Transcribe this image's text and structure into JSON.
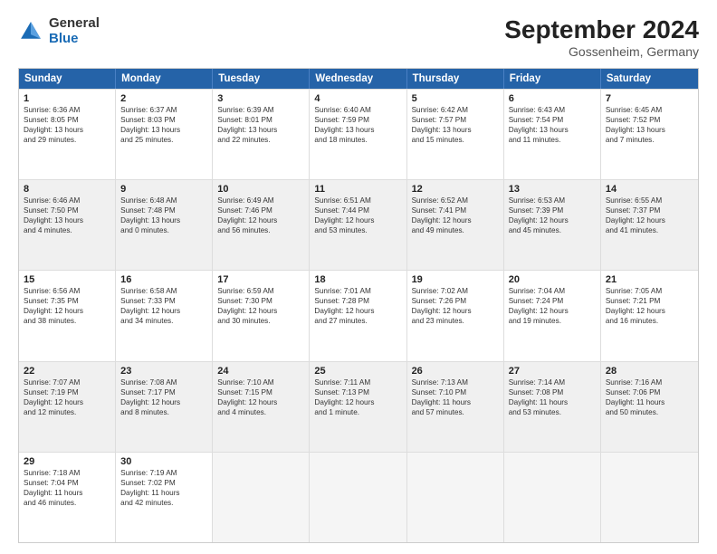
{
  "header": {
    "logo_general": "General",
    "logo_blue": "Blue",
    "month_title": "September 2024",
    "location": "Gossenheim, Germany"
  },
  "weekdays": [
    "Sunday",
    "Monday",
    "Tuesday",
    "Wednesday",
    "Thursday",
    "Friday",
    "Saturday"
  ],
  "rows": [
    [
      {
        "day": "1",
        "lines": [
          "Sunrise: 6:36 AM",
          "Sunset: 8:05 PM",
          "Daylight: 13 hours",
          "and 29 minutes."
        ]
      },
      {
        "day": "2",
        "lines": [
          "Sunrise: 6:37 AM",
          "Sunset: 8:03 PM",
          "Daylight: 13 hours",
          "and 25 minutes."
        ]
      },
      {
        "day": "3",
        "lines": [
          "Sunrise: 6:39 AM",
          "Sunset: 8:01 PM",
          "Daylight: 13 hours",
          "and 22 minutes."
        ]
      },
      {
        "day": "4",
        "lines": [
          "Sunrise: 6:40 AM",
          "Sunset: 7:59 PM",
          "Daylight: 13 hours",
          "and 18 minutes."
        ]
      },
      {
        "day": "5",
        "lines": [
          "Sunrise: 6:42 AM",
          "Sunset: 7:57 PM",
          "Daylight: 13 hours",
          "and 15 minutes."
        ]
      },
      {
        "day": "6",
        "lines": [
          "Sunrise: 6:43 AM",
          "Sunset: 7:54 PM",
          "Daylight: 13 hours",
          "and 11 minutes."
        ]
      },
      {
        "day": "7",
        "lines": [
          "Sunrise: 6:45 AM",
          "Sunset: 7:52 PM",
          "Daylight: 13 hours",
          "and 7 minutes."
        ]
      }
    ],
    [
      {
        "day": "8",
        "lines": [
          "Sunrise: 6:46 AM",
          "Sunset: 7:50 PM",
          "Daylight: 13 hours",
          "and 4 minutes."
        ]
      },
      {
        "day": "9",
        "lines": [
          "Sunrise: 6:48 AM",
          "Sunset: 7:48 PM",
          "Daylight: 13 hours",
          "and 0 minutes."
        ]
      },
      {
        "day": "10",
        "lines": [
          "Sunrise: 6:49 AM",
          "Sunset: 7:46 PM",
          "Daylight: 12 hours",
          "and 56 minutes."
        ]
      },
      {
        "day": "11",
        "lines": [
          "Sunrise: 6:51 AM",
          "Sunset: 7:44 PM",
          "Daylight: 12 hours",
          "and 53 minutes."
        ]
      },
      {
        "day": "12",
        "lines": [
          "Sunrise: 6:52 AM",
          "Sunset: 7:41 PM",
          "Daylight: 12 hours",
          "and 49 minutes."
        ]
      },
      {
        "day": "13",
        "lines": [
          "Sunrise: 6:53 AM",
          "Sunset: 7:39 PM",
          "Daylight: 12 hours",
          "and 45 minutes."
        ]
      },
      {
        "day": "14",
        "lines": [
          "Sunrise: 6:55 AM",
          "Sunset: 7:37 PM",
          "Daylight: 12 hours",
          "and 41 minutes."
        ]
      }
    ],
    [
      {
        "day": "15",
        "lines": [
          "Sunrise: 6:56 AM",
          "Sunset: 7:35 PM",
          "Daylight: 12 hours",
          "and 38 minutes."
        ]
      },
      {
        "day": "16",
        "lines": [
          "Sunrise: 6:58 AM",
          "Sunset: 7:33 PM",
          "Daylight: 12 hours",
          "and 34 minutes."
        ]
      },
      {
        "day": "17",
        "lines": [
          "Sunrise: 6:59 AM",
          "Sunset: 7:30 PM",
          "Daylight: 12 hours",
          "and 30 minutes."
        ]
      },
      {
        "day": "18",
        "lines": [
          "Sunrise: 7:01 AM",
          "Sunset: 7:28 PM",
          "Daylight: 12 hours",
          "and 27 minutes."
        ]
      },
      {
        "day": "19",
        "lines": [
          "Sunrise: 7:02 AM",
          "Sunset: 7:26 PM",
          "Daylight: 12 hours",
          "and 23 minutes."
        ]
      },
      {
        "day": "20",
        "lines": [
          "Sunrise: 7:04 AM",
          "Sunset: 7:24 PM",
          "Daylight: 12 hours",
          "and 19 minutes."
        ]
      },
      {
        "day": "21",
        "lines": [
          "Sunrise: 7:05 AM",
          "Sunset: 7:21 PM",
          "Daylight: 12 hours",
          "and 16 minutes."
        ]
      }
    ],
    [
      {
        "day": "22",
        "lines": [
          "Sunrise: 7:07 AM",
          "Sunset: 7:19 PM",
          "Daylight: 12 hours",
          "and 12 minutes."
        ]
      },
      {
        "day": "23",
        "lines": [
          "Sunrise: 7:08 AM",
          "Sunset: 7:17 PM",
          "Daylight: 12 hours",
          "and 8 minutes."
        ]
      },
      {
        "day": "24",
        "lines": [
          "Sunrise: 7:10 AM",
          "Sunset: 7:15 PM",
          "Daylight: 12 hours",
          "and 4 minutes."
        ]
      },
      {
        "day": "25",
        "lines": [
          "Sunrise: 7:11 AM",
          "Sunset: 7:13 PM",
          "Daylight: 12 hours",
          "and 1 minute."
        ]
      },
      {
        "day": "26",
        "lines": [
          "Sunrise: 7:13 AM",
          "Sunset: 7:10 PM",
          "Daylight: 11 hours",
          "and 57 minutes."
        ]
      },
      {
        "day": "27",
        "lines": [
          "Sunrise: 7:14 AM",
          "Sunset: 7:08 PM",
          "Daylight: 11 hours",
          "and 53 minutes."
        ]
      },
      {
        "day": "28",
        "lines": [
          "Sunrise: 7:16 AM",
          "Sunset: 7:06 PM",
          "Daylight: 11 hours",
          "and 50 minutes."
        ]
      }
    ],
    [
      {
        "day": "29",
        "lines": [
          "Sunrise: 7:18 AM",
          "Sunset: 7:04 PM",
          "Daylight: 11 hours",
          "and 46 minutes."
        ]
      },
      {
        "day": "30",
        "lines": [
          "Sunrise: 7:19 AM",
          "Sunset: 7:02 PM",
          "Daylight: 11 hours",
          "and 42 minutes."
        ]
      },
      {
        "day": "",
        "lines": []
      },
      {
        "day": "",
        "lines": []
      },
      {
        "day": "",
        "lines": []
      },
      {
        "day": "",
        "lines": []
      },
      {
        "day": "",
        "lines": []
      }
    ]
  ]
}
